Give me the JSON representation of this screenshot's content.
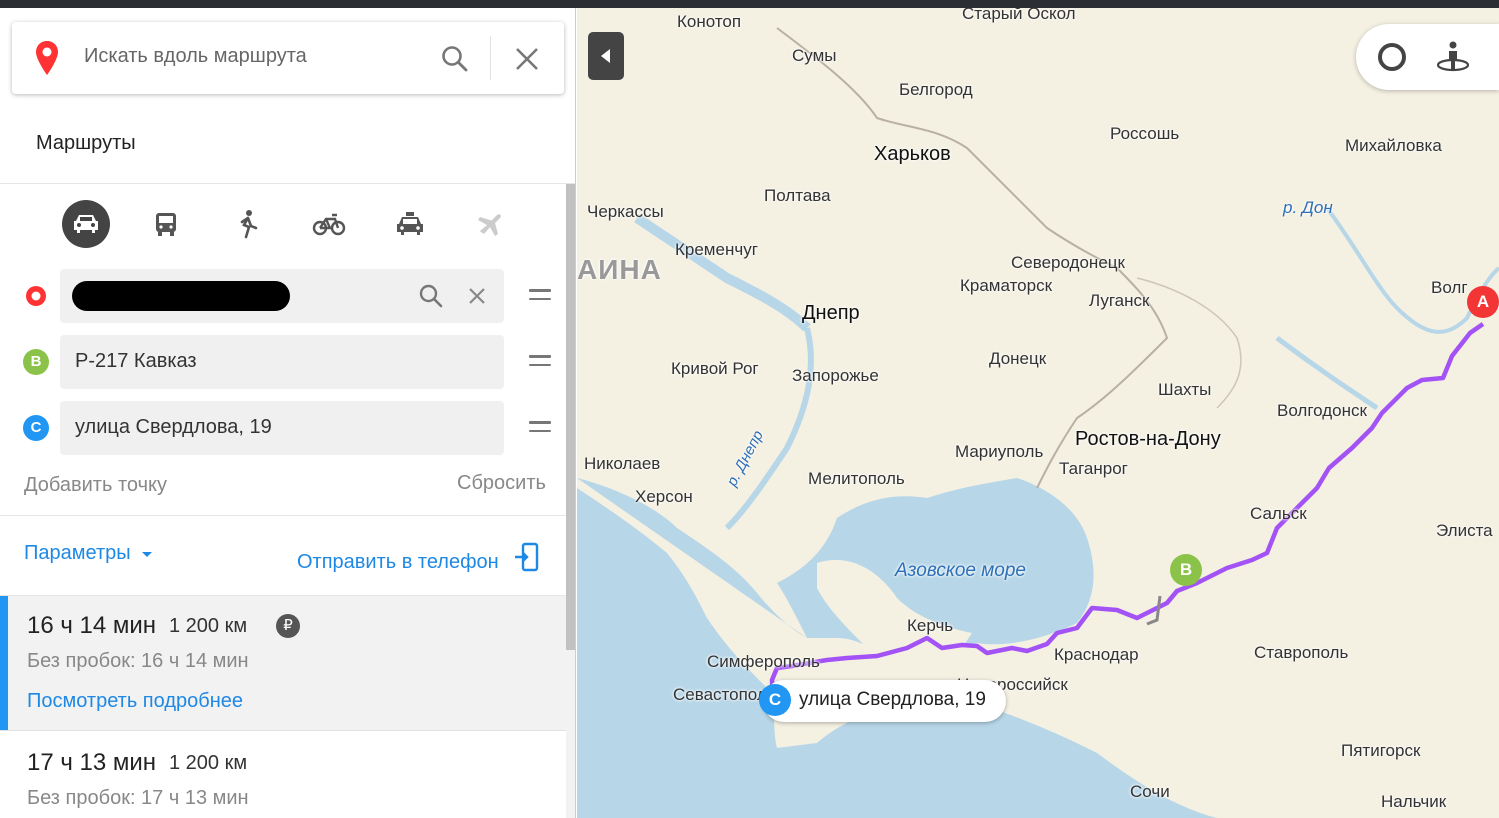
{
  "search": {
    "placeholder": "Искать вдоль маршрута",
    "icon": "search-icon",
    "clear_icon": "close-icon"
  },
  "sidebar": {
    "title": "Маршруты",
    "modes": [
      {
        "name": "car",
        "icon": "car-icon",
        "active": true
      },
      {
        "name": "bus",
        "icon": "bus-icon",
        "active": false
      },
      {
        "name": "walk",
        "icon": "pedestrian-icon",
        "active": false
      },
      {
        "name": "bike",
        "icon": "bicycle-icon",
        "active": false
      },
      {
        "name": "taxi",
        "icon": "taxi-icon",
        "active": false
      },
      {
        "name": "plane",
        "icon": "plane-icon",
        "active": false
      }
    ],
    "points": [
      {
        "marker": "",
        "value": "",
        "redacted": true
      },
      {
        "marker": "B",
        "value": "Р-217 Кавказ"
      },
      {
        "marker": "C",
        "value": "улица Свердлова, 19"
      }
    ],
    "add_point": "Добавить точку",
    "reset": "Сбросить",
    "params": "Параметры",
    "send": "Отправить в телефон",
    "routes": [
      {
        "time": "16 ч 14 мин",
        "distance": "1 200 км",
        "toll_icon": "₽",
        "no_traffic": "Без пробок: 16 ч 14 мин",
        "details": "Посмотреть подробнее",
        "selected": true
      },
      {
        "time": "17 ч 13 мин",
        "distance": "1 200 км",
        "no_traffic": "Без пробок: 17 ч 13 мин",
        "selected": false
      }
    ]
  },
  "map": {
    "cities": {
      "konotop": "Конотоп",
      "stary_oskol": "Старый Оскол",
      "sumy": "Сумы",
      "belgorod": "Белгород",
      "kharkov": "Харьков",
      "rossosh": "Россошь",
      "mikhaylovka": "Михайловка",
      "poltava": "Полтава",
      "cherkassy": "Черкассы",
      "kremenchug": "Кременчуг",
      "severodonetsk": "Северодонецк",
      "kramatorsk": "Краматорск",
      "lugansk": "Луганск",
      "dnepr": "Днепр",
      "krivoy_rog": "Кривой Рог",
      "zaporozhye": "Запорожье",
      "donetsk": "Донецк",
      "shakhty": "Шахты",
      "volgodonsk": "Волгодонск",
      "mariupol": "Мариуполь",
      "rostov": "Ростов-на-Дону",
      "taganrog": "Таганрог",
      "nikolaev": "Николаев",
      "kherson": "Херсон",
      "melitopol": "Мелитополь",
      "salsk": "Сальск",
      "elista": "Элиста",
      "kerch": "Керчь",
      "simferopol": "Симферополь",
      "krasnodar": "Краснодар",
      "stavropol": "Ставрополь",
      "sevastopol": "Севастопол",
      "novorossiysk": "Новороссийск",
      "pyatigorsk": "Пятигорск",
      "sochi": "Сочи",
      "nalchik": "Нальчик",
      "volgo_partial": "Волг"
    },
    "water": {
      "don": "р. Дон",
      "dnepr_river": "р. Днепр",
      "azov": "Азовское море"
    },
    "country": "АИНА",
    "markers": {
      "a": "A",
      "b": "B",
      "c": "C"
    },
    "destination_label": "улица Свердлова, 19",
    "colors": {
      "route": "#a352f5",
      "sea": "#b7d6e8",
      "land": "#f4f0e2",
      "marker_a": "#f33535",
      "marker_b": "#8bc34a",
      "marker_c": "#2196f3"
    },
    "controls": {
      "alice_icon": "alice-icon",
      "panorama_icon": "panorama-icon",
      "collapse_icon": "collapse-panel-icon"
    }
  }
}
